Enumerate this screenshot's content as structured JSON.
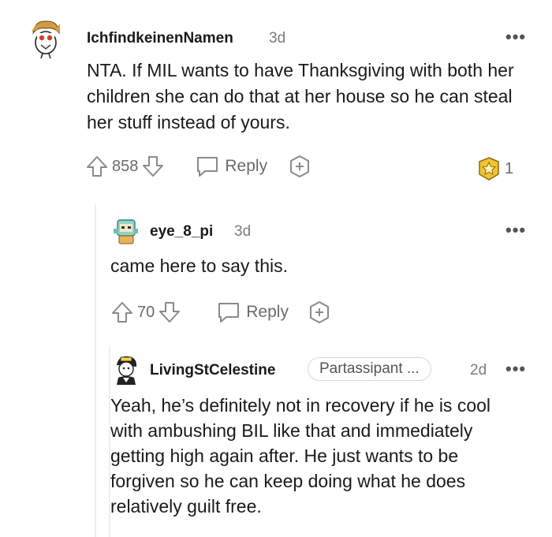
{
  "comments": [
    {
      "author": "IchfindkeinenNamen",
      "age": "3d",
      "text": "NTA. If MIL wants to have Thanksgiving with both her children she can do that at her house so he can steal her stuff instead of yours.",
      "votes": "858",
      "reply_label": "Reply",
      "award_count": "1",
      "more": "•••"
    },
    {
      "author": "eye_8_pi",
      "age": "3d",
      "text": "came here to say this.",
      "votes": "70",
      "reply_label": "Reply",
      "more": "•••"
    },
    {
      "author": "LivingStCelestine",
      "flair": "Partassipant ...",
      "age": "2d",
      "text": "Yeah, he’s definitely not in recovery if he is cool with ambushing BIL like that and immediately getting high again after. He just wants to be forgiven so he can keep doing what he does relatively guilt free.",
      "more": "•••"
    }
  ]
}
